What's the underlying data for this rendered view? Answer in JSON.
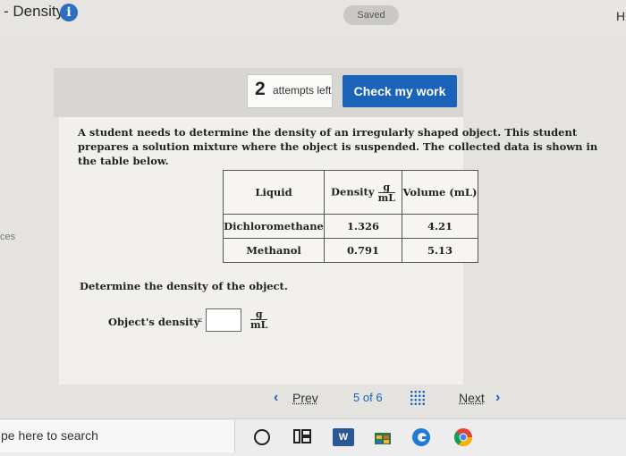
{
  "header": {
    "title": "- Density",
    "info_icon": "info-icon",
    "saved_label": "Saved",
    "right_edge_text": "H"
  },
  "toolbar": {
    "attempts_count": "2",
    "attempts_text": "attempts left",
    "check_button_label": "Check my work"
  },
  "question": {
    "text": "A student needs to determine the density of an irregularly shaped object. This student prepares a solution mixture where the object is suspended. The collected data is shown in the table below."
  },
  "table": {
    "headers": {
      "liquid": "Liquid",
      "density": "Density",
      "density_unit_num": "g",
      "density_unit_den": "mL",
      "volume": "Volume (mL)"
    },
    "rows": [
      {
        "liquid": "Dichloromethane",
        "density": "1.326",
        "volume": "4.21"
      },
      {
        "liquid": "Methanol",
        "density": "0.791",
        "volume": "5.13"
      }
    ]
  },
  "sidebar_fragment": "ces",
  "prompt": {
    "determine_text": "Determine the density of the object.",
    "density_label": "Object's density",
    "equals": "=",
    "answer_value": "",
    "unit_num": "g",
    "unit_den": "mL"
  },
  "pagination": {
    "prev_label": "Prev",
    "current": "5",
    "of_text": "of",
    "total": "6",
    "next_label": "Next"
  },
  "taskbar": {
    "search_placeholder": "pe here to search",
    "word_letter": "W",
    "accent_blue": "#1a63b8"
  }
}
